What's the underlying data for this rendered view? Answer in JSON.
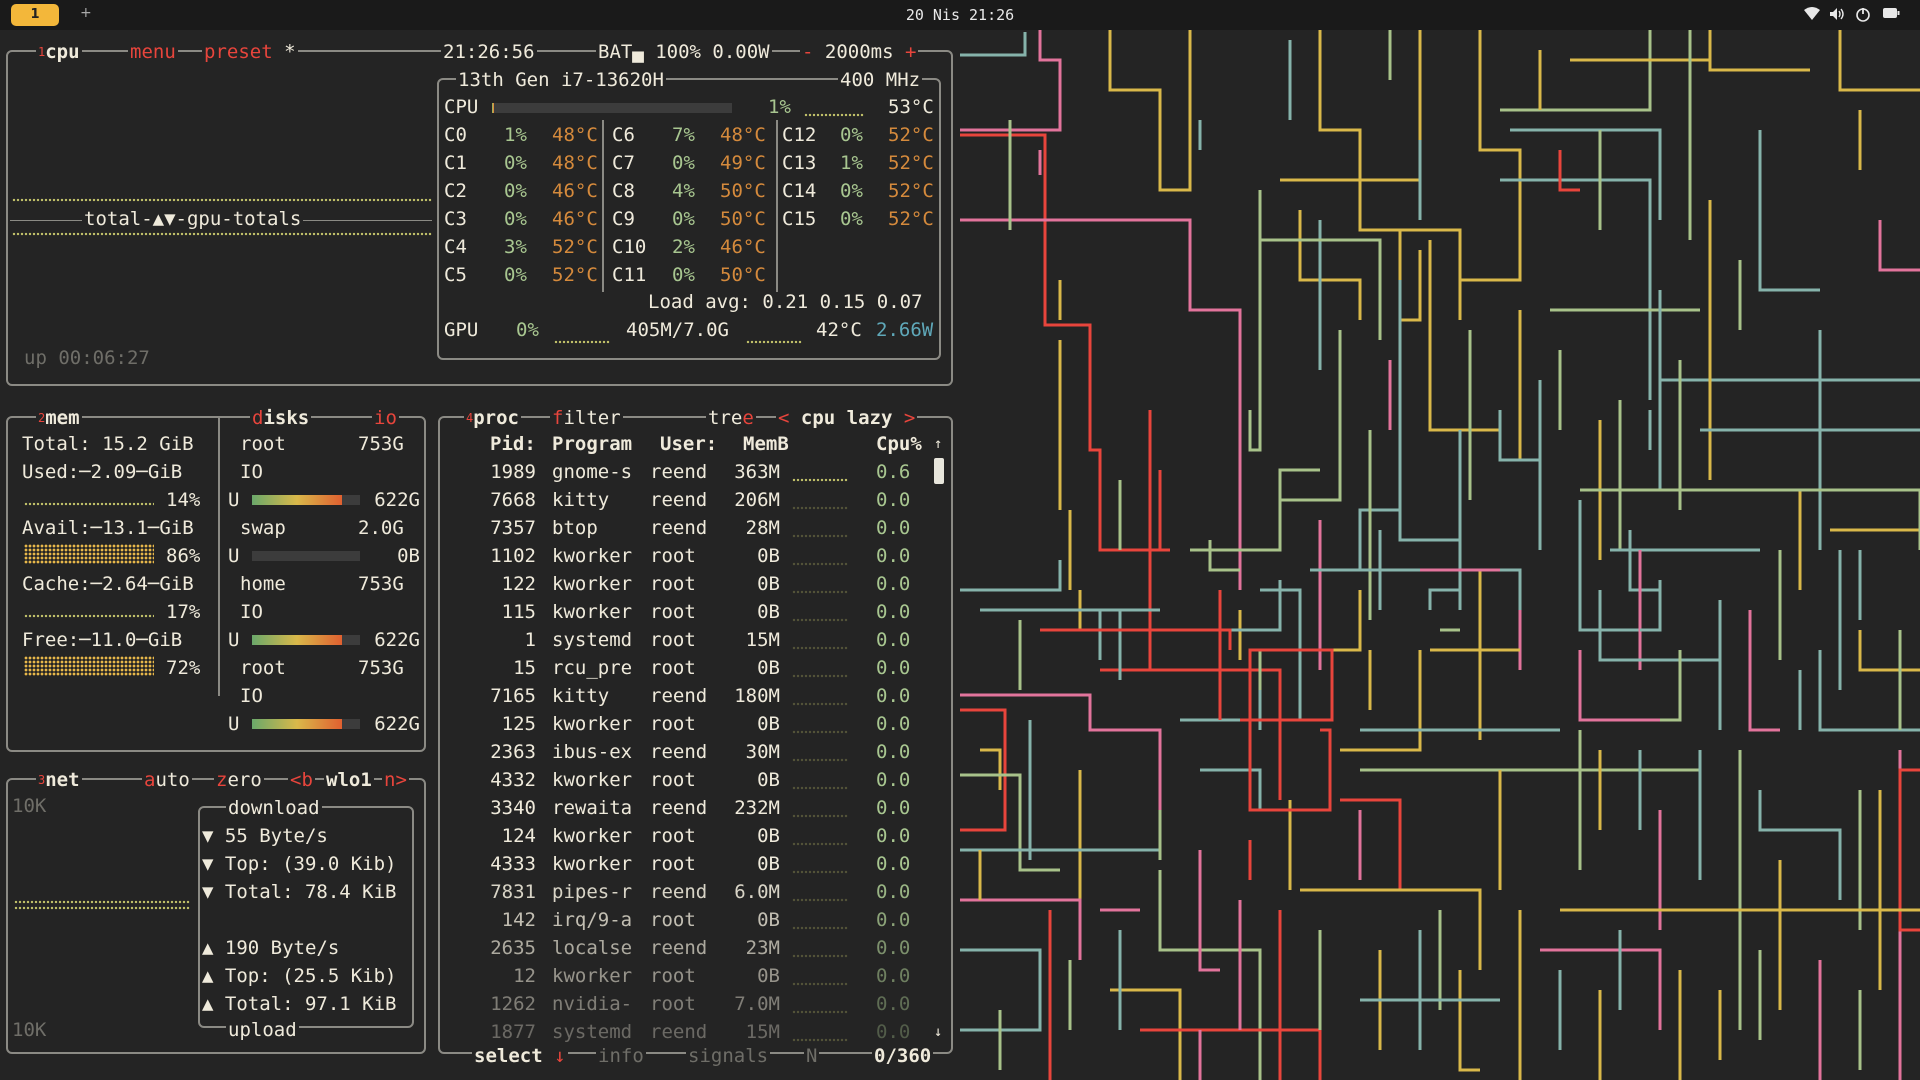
{
  "topbar": {
    "workspace": "1",
    "add": "+",
    "clock": "20 Nis 21:26",
    "tray_icons": [
      "wifi-icon",
      "volume-icon",
      "power-icon",
      "battery-icon"
    ]
  },
  "cpu": {
    "num": "1",
    "title": "cpu",
    "menu": "menu",
    "preset": "preset",
    "preset_mark": "*",
    "time": "21:26:56",
    "battery": "BAT▄ 100% 0.00W",
    "interval_minus": "-",
    "interval": "2000ms",
    "interval_plus": "+",
    "model": "13th Gen i7-13620H",
    "freq": "400 MHz",
    "graph_label": "total-▲▼-gpu-totals",
    "uptime": "up 00:06:27",
    "total_label": "CPU",
    "total_pct": "1%",
    "total_temp": "53°C",
    "total_fill": 0.01,
    "cores_col1": [
      {
        "n": "C0",
        "p": "1%",
        "t": "48°C"
      },
      {
        "n": "C1",
        "p": "0%",
        "t": "48°C"
      },
      {
        "n": "C2",
        "p": "0%",
        "t": "46°C"
      },
      {
        "n": "C3",
        "p": "0%",
        "t": "46°C"
      },
      {
        "n": "C4",
        "p": "3%",
        "t": "52°C"
      },
      {
        "n": "C5",
        "p": "0%",
        "t": "52°C"
      }
    ],
    "cores_col2": [
      {
        "n": "C6",
        "p": "7%",
        "t": "48°C"
      },
      {
        "n": "C7",
        "p": "0%",
        "t": "49°C"
      },
      {
        "n": "C8",
        "p": "4%",
        "t": "50°C"
      },
      {
        "n": "C9",
        "p": "0%",
        "t": "50°C"
      },
      {
        "n": "C10",
        "p": "2%",
        "t": "46°C"
      },
      {
        "n": "C11",
        "p": "0%",
        "t": "50°C"
      }
    ],
    "cores_col3": [
      {
        "n": "C12",
        "p": "0%",
        "t": "52°C"
      },
      {
        "n": "C13",
        "p": "1%",
        "t": "52°C"
      },
      {
        "n": "C14",
        "p": "0%",
        "t": "52°C"
      },
      {
        "n": "C15",
        "p": "0%",
        "t": "52°C"
      }
    ],
    "load": "Load avg: 0.21 0.15 0.07",
    "gpu_label": "GPU",
    "gpu_pct": "0%",
    "gpu_mem": "405M/7.0G",
    "gpu_temp": "42°C",
    "gpu_power": "2.66W"
  },
  "mem": {
    "num": "2",
    "title": "mem",
    "total": "Total: 15.2 GiB",
    "used": "Used:",
    "used_v": "2.09",
    "used_pct": "14%",
    "avail": "Avail:",
    "avail_v": "13.1",
    "avail_pct": "86%",
    "cache": "Cache:",
    "cache_v": "2.64",
    "cache_pct": "17%",
    "free": "Free:",
    "free_v": "11.0",
    "free_pct": "72%",
    "unit": "GiB"
  },
  "disks": {
    "title": "disks",
    "io": "io",
    "items": [
      {
        "name": "root",
        "size": "753G",
        "io": "IO",
        "u": "U",
        "used": "622G",
        "fill": 0.83
      },
      {
        "name": "swap",
        "size": "2.0G",
        "io": "",
        "u": "U",
        "used": "0B",
        "fill": 0.0
      },
      {
        "name": "home",
        "size": "753G",
        "io": "IO",
        "u": "U",
        "used": "622G",
        "fill": 0.83
      },
      {
        "name": "root",
        "size": "753G",
        "io": "IO",
        "u": "U",
        "used": "622G",
        "fill": 0.83
      }
    ]
  },
  "net": {
    "num": "3",
    "title": "net",
    "auto": "auto",
    "zero": "zero",
    "prev": "<b",
    "iface": "wlo1",
    "next": "n>",
    "scale_top": "10K",
    "scale_bottom": "10K",
    "download": "download",
    "upload": "upload",
    "dl_rate": "▼ 55 Byte/s",
    "dl_top": "▼ Top: (39.0 Kib)",
    "dl_total": "▼ Total: 78.4 KiB",
    "ul_rate": "▲ 190 Byte/s",
    "ul_top": "▲ Top: (25.5 Kib)",
    "ul_total": "▲ Total: 97.1 KiB"
  },
  "proc": {
    "num": "4",
    "title": "proc",
    "filter": "filter",
    "tree": "tre",
    "tree_key": "e",
    "sort_left": "<",
    "sort": "cpu lazy",
    "sort_right": ">",
    "col_pid": "Pid:",
    "col_program": "Program",
    "col_user": "User:",
    "col_mem": "MemB",
    "col_cpu": "Cpu%",
    "rows": [
      {
        "pid": "1989",
        "prog": "gnome-s",
        "user": "reend",
        "mem": "363M",
        "cpu": "0.6"
      },
      {
        "pid": "7668",
        "prog": "kitty",
        "user": "reend",
        "mem": "206M",
        "cpu": "0.0"
      },
      {
        "pid": "7357",
        "prog": "btop",
        "user": "reend",
        "mem": "28M",
        "cpu": "0.0"
      },
      {
        "pid": "1102",
        "prog": "kworker",
        "user": "root",
        "mem": "0B",
        "cpu": "0.0"
      },
      {
        "pid": "122",
        "prog": "kworker",
        "user": "root",
        "mem": "0B",
        "cpu": "0.0"
      },
      {
        "pid": "115",
        "prog": "kworker",
        "user": "root",
        "mem": "0B",
        "cpu": "0.0"
      },
      {
        "pid": "1",
        "prog": "systemd",
        "user": "root",
        "mem": "15M",
        "cpu": "0.0"
      },
      {
        "pid": "15",
        "prog": "rcu_pre",
        "user": "root",
        "mem": "0B",
        "cpu": "0.0"
      },
      {
        "pid": "7165",
        "prog": "kitty",
        "user": "reend",
        "mem": "180M",
        "cpu": "0.0"
      },
      {
        "pid": "125",
        "prog": "kworker",
        "user": "root",
        "mem": "0B",
        "cpu": "0.0"
      },
      {
        "pid": "2363",
        "prog": "ibus-ex",
        "user": "reend",
        "mem": "30M",
        "cpu": "0.0"
      },
      {
        "pid": "4332",
        "prog": "kworker",
        "user": "root",
        "mem": "0B",
        "cpu": "0.0"
      },
      {
        "pid": "3340",
        "prog": "rewaita",
        "user": "reend",
        "mem": "232M",
        "cpu": "0.0"
      },
      {
        "pid": "124",
        "prog": "kworker",
        "user": "root",
        "mem": "0B",
        "cpu": "0.0"
      },
      {
        "pid": "4333",
        "prog": "kworker",
        "user": "root",
        "mem": "0B",
        "cpu": "0.0"
      },
      {
        "pid": "7831",
        "prog": "pipes-r",
        "user": "reend",
        "mem": "6.0M",
        "cpu": "0.0"
      },
      {
        "pid": "142",
        "prog": "irq/9-a",
        "user": "root",
        "mem": "0B",
        "cpu": "0.0"
      },
      {
        "pid": "2635",
        "prog": "localse",
        "user": "reend",
        "mem": "23M",
        "cpu": "0.0"
      },
      {
        "pid": "12",
        "prog": "kworker",
        "user": "root",
        "mem": "0B",
        "cpu": "0.0"
      },
      {
        "pid": "1262",
        "prog": "nvidia-",
        "user": "root",
        "mem": "7.0M",
        "cpu": "0.0"
      },
      {
        "pid": "1877",
        "prog": "systemd",
        "user": "reend",
        "mem": "15M",
        "cpu": "0.0"
      }
    ],
    "select": "select",
    "info": "info",
    "signals": "signals",
    "n": "N",
    "count": "0/360",
    "arrow_up": "↑",
    "arrow_down": "↓"
  },
  "colors": {
    "background": "#242424",
    "border": "#8b8a84",
    "accent_red": "#e8453c",
    "green": "#a8c690",
    "orange": "#d58a3c",
    "cyan": "#5fa8b9",
    "pipe_colors": [
      "#d9b84a",
      "#e8453c",
      "#e2749c",
      "#86b3ab",
      "#a8c28a"
    ]
  }
}
